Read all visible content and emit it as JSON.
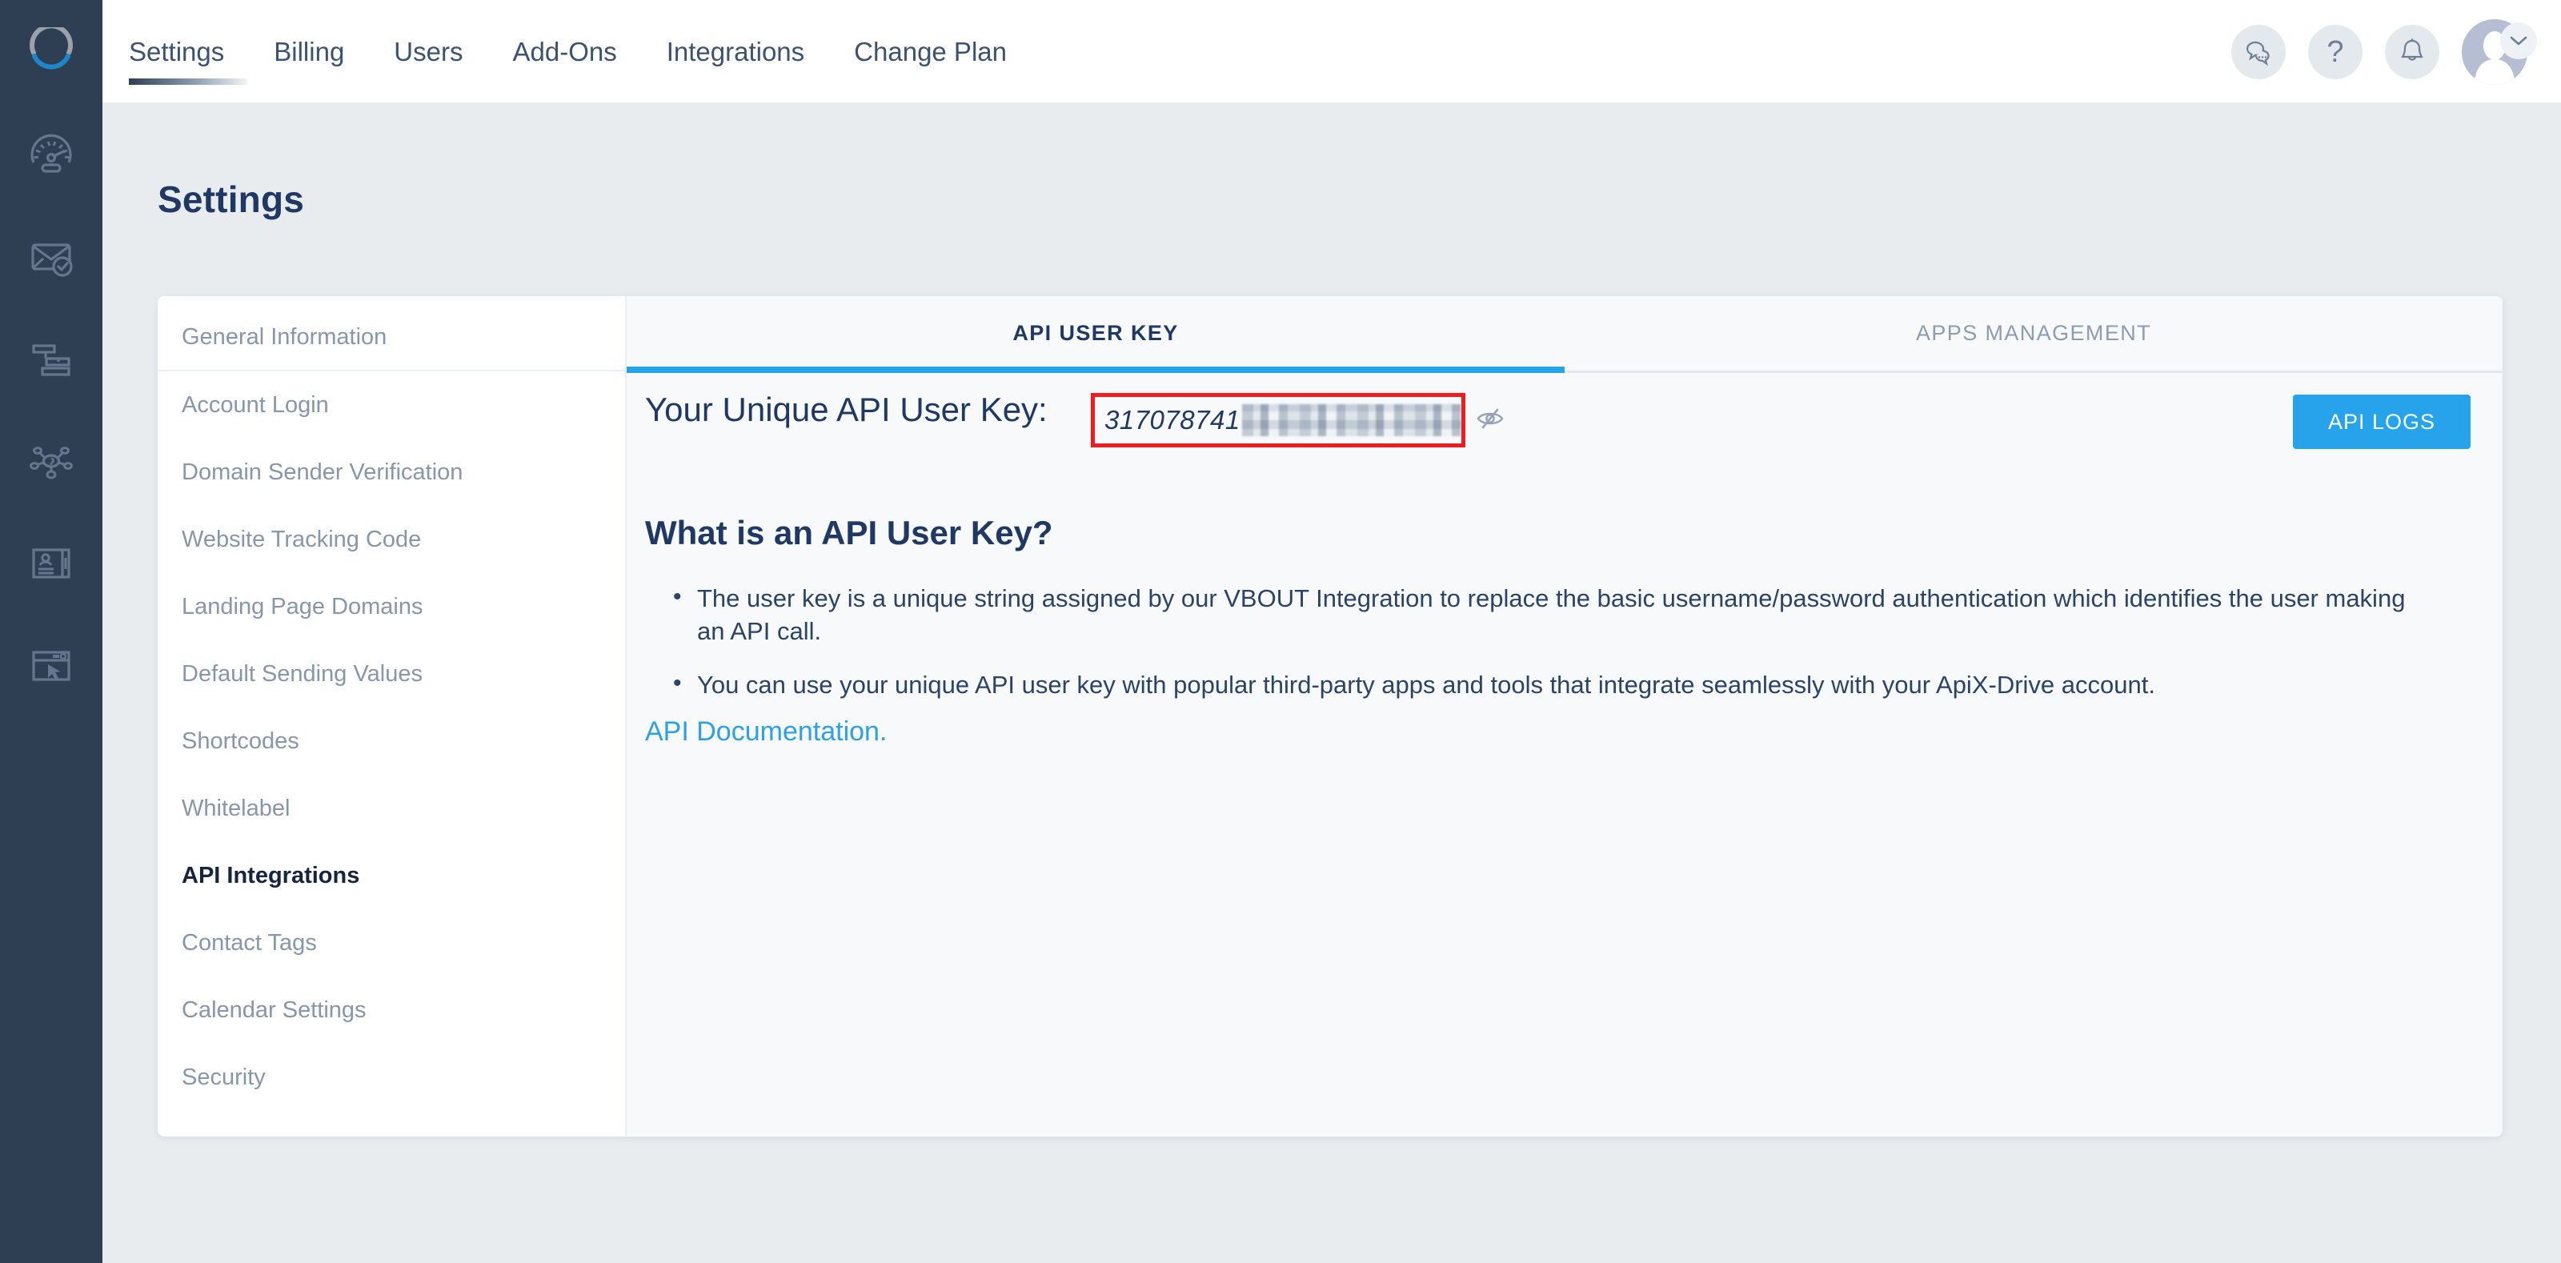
{
  "brand": {
    "logo_icon": "circle-loader-logo",
    "accent_blue": "#27a3eb",
    "dark_navy": "#2e3e53",
    "title_navy": "#1f3864",
    "highlight_red": "#ee1c1c"
  },
  "rail": {
    "items": [
      {
        "icon": "dashboard-speedometer-icon",
        "name": "dashboard"
      },
      {
        "icon": "email-verified-icon",
        "name": "email-campaigns"
      },
      {
        "icon": "workflow-automation-icon",
        "name": "automation"
      },
      {
        "icon": "network-nodes-icon",
        "name": "integrations"
      },
      {
        "icon": "contact-card-icon",
        "name": "contacts"
      },
      {
        "icon": "landing-page-cursor-icon",
        "name": "landing-pages"
      }
    ]
  },
  "topnav": {
    "items": [
      {
        "label": "Settings",
        "active": true
      },
      {
        "label": "Billing",
        "active": false
      },
      {
        "label": "Users",
        "active": false
      },
      {
        "label": "Add-Ons",
        "active": false
      },
      {
        "label": "Integrations",
        "active": false
      },
      {
        "label": "Change Plan",
        "active": false
      }
    ]
  },
  "topbar_right": {
    "chat_icon": "chat-bubbles-icon",
    "help_icon": "question-mark-icon",
    "help_label": "?",
    "notifications_icon": "bell-icon",
    "avatar_icon": "user-avatar",
    "chevron_icon": "chevron-down-icon"
  },
  "page": {
    "title": "Settings"
  },
  "settings_menu": {
    "items": [
      {
        "label": "General Information",
        "active": false,
        "divider_after": true
      },
      {
        "label": "Account Login",
        "active": false,
        "divider_after": false
      },
      {
        "label": "Domain Sender Verification",
        "active": false,
        "divider_after": false
      },
      {
        "label": "Website Tracking Code",
        "active": false,
        "divider_after": false
      },
      {
        "label": "Landing Page Domains",
        "active": false,
        "divider_after": false
      },
      {
        "label": "Default Sending Values",
        "active": false,
        "divider_after": false
      },
      {
        "label": "Shortcodes",
        "active": false,
        "divider_after": false
      },
      {
        "label": "Whitelabel",
        "active": false,
        "divider_after": false
      },
      {
        "label": "API Integrations",
        "active": true,
        "divider_after": false
      },
      {
        "label": "Contact Tags",
        "active": false,
        "divider_after": false
      },
      {
        "label": "Calendar Settings",
        "active": false,
        "divider_after": false
      },
      {
        "label": "Security",
        "active": false,
        "divider_after": false
      }
    ]
  },
  "tabs": [
    {
      "label": "API USER KEY",
      "active": true
    },
    {
      "label": "APPS MANAGEMENT",
      "active": false
    }
  ],
  "api_key": {
    "label": "Your Unique API User Key:",
    "visible_value": "317078741",
    "redacted": true,
    "toggle_icon": "eye-slash-icon",
    "logs_button_label": "API LOGS"
  },
  "content": {
    "heading": "What is an API User Key?",
    "bullets": [
      "The user key is a unique string assigned by our VBOUT Integration to replace the basic username/password authentication which identifies the user making an API call.",
      "You can use your unique API user key with popular third-party apps and tools that integrate seamlessly with your ApiX-Drive account."
    ],
    "documentation_link": "API Documentation."
  }
}
